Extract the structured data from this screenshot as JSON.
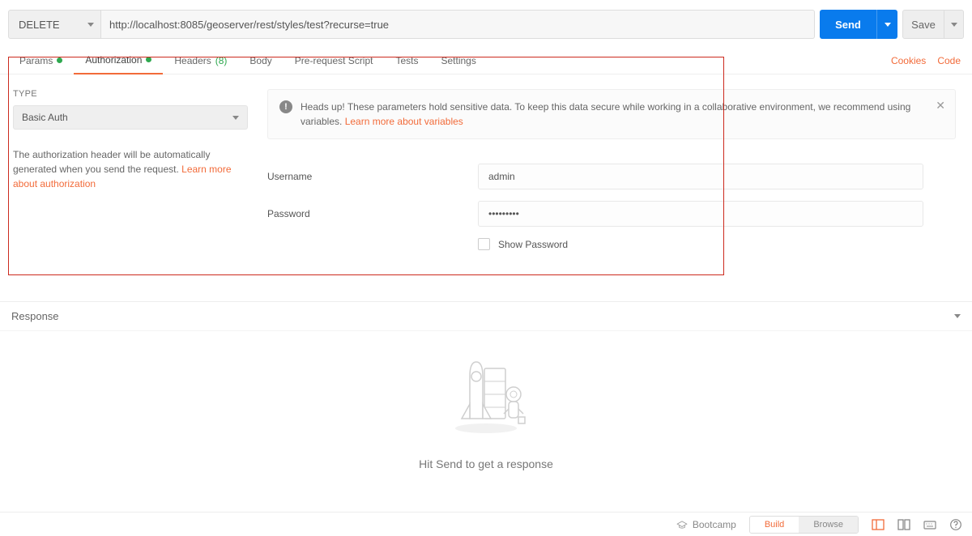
{
  "request": {
    "method": "DELETE",
    "url": "http://localhost:8085/geoserver/rest/styles/test?recurse=true",
    "send_label": "Send",
    "save_label": "Save"
  },
  "tabs": {
    "params": "Params",
    "authorization": "Authorization",
    "headers": "Headers",
    "headers_count": "(8)",
    "body": "Body",
    "prerequest": "Pre-request Script",
    "tests": "Tests",
    "settings": "Settings"
  },
  "rightlinks": {
    "cookies": "Cookies",
    "code": "Code"
  },
  "auth": {
    "type_label": "TYPE",
    "type_value": "Basic Auth",
    "help_text": "The authorization header will be automatically generated when you send the request. ",
    "help_link": "Learn more about authorization",
    "alert_text": "Heads up! These parameters hold sensitive data. To keep this data secure while working in a collaborative environment, we recommend using variables. ",
    "alert_link": "Learn more about variables",
    "username_label": "Username",
    "username_value": "admin",
    "password_label": "Password",
    "password_value": "•••••••••",
    "show_password": "Show Password"
  },
  "response": {
    "title": "Response",
    "empty_msg": "Hit Send to get a response"
  },
  "footer": {
    "bootcamp": "Bootcamp",
    "build": "Build",
    "browse": "Browse"
  }
}
